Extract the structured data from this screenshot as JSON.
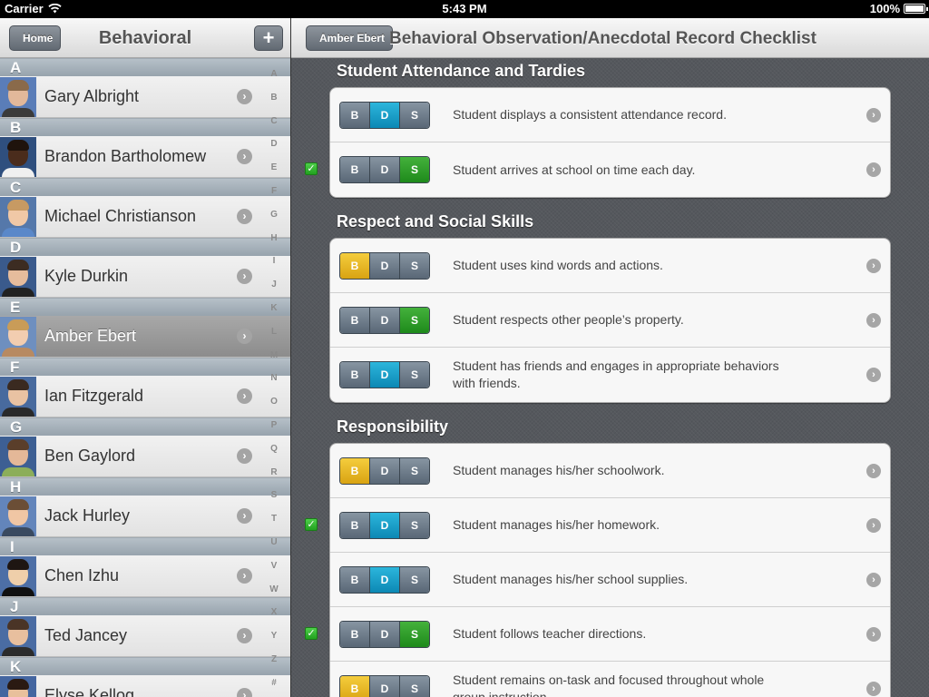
{
  "status_bar": {
    "carrier": "Carrier",
    "time": "5:43 PM",
    "battery": "100%"
  },
  "master": {
    "title": "Behavioral",
    "home_label": "Home",
    "add_label": "+",
    "sections": [
      {
        "letter": "A",
        "student": "Gary Albright",
        "skin": "#e2b89a",
        "hair": "#8a6a4a",
        "shirt": "#3b3b3b",
        "bg": "#5a7db8"
      },
      {
        "letter": "B",
        "student": "Brandon Bartholomew",
        "skin": "#4a2c1c",
        "hair": "#1f130c",
        "shirt": "#f0f0f0",
        "bg": "#2f4f7e"
      },
      {
        "letter": "C",
        "student": "Michael Christianson",
        "skin": "#f0c8a6",
        "hair": "#c79a63",
        "shirt": "#5a88c9",
        "bg": "#5578aa"
      },
      {
        "letter": "D",
        "student": "Kyle Durkin",
        "skin": "#e6bc9c",
        "hair": "#3c2c22",
        "shirt": "#222222",
        "bg": "#3a5a8c"
      },
      {
        "letter": "E",
        "student": "Amber Ebert",
        "skin": "#f2cdb0",
        "hair": "#c99c58",
        "shirt": "#b78a62",
        "bg": "#6e8fbf",
        "selected": true
      },
      {
        "letter": "F",
        "student": "Ian Fitzgerald",
        "skin": "#e9c2a2",
        "hair": "#3a2a20",
        "shirt": "#2a2a2a",
        "bg": "#486a9e"
      },
      {
        "letter": "G",
        "student": "Ben Gaylord",
        "skin": "#e4b898",
        "hair": "#5a3e2a",
        "shirt": "#8cae5a",
        "bg": "#3d5f93"
      },
      {
        "letter": "H",
        "student": "Jack Hurley",
        "skin": "#f0c6a4",
        "hair": "#6b4e36",
        "shirt": "#3a4a60",
        "bg": "#6385bb"
      },
      {
        "letter": "I",
        "student": "Chen Izhu",
        "skin": "#efcfaa",
        "hair": "#1e1612",
        "shirt": "#111111",
        "bg": "#4d6fa6"
      },
      {
        "letter": "J",
        "student": "Ted Jancey",
        "skin": "#e8bf9e",
        "hair": "#4a3426",
        "shirt": "#2c2c2c",
        "bg": "#4a6ca3"
      },
      {
        "letter": "K",
        "student": "Elyse Kellog",
        "skin": "#e8c09c",
        "hair": "#2a1a12",
        "shirt": "#7a3a3a",
        "bg": "#4466a0"
      }
    ],
    "index_letters": [
      "A",
      "B",
      "C",
      "D",
      "E",
      "F",
      "G",
      "H",
      "I",
      "J",
      "K",
      "L",
      "M",
      "N",
      "O",
      "P",
      "Q",
      "R",
      "S",
      "T",
      "U",
      "V",
      "W",
      "X",
      "Y",
      "Z",
      "#"
    ]
  },
  "detail": {
    "back_label": "Amber Ebert",
    "title": "Behavioral Observation/Anecdotal Record Checklist",
    "options": [
      "B",
      "D",
      "S"
    ],
    "sections": [
      {
        "title": "Student Attendance and Tardies",
        "items": [
          {
            "text": "Student displays a consistent attendance record.",
            "selected": "D",
            "checked": false
          },
          {
            "text": "Student arrives at school on time each day.",
            "selected": "S",
            "checked": true
          }
        ]
      },
      {
        "title": "Respect and Social Skills",
        "items": [
          {
            "text": "Student uses kind words and actions.",
            "selected": "B",
            "checked": false
          },
          {
            "text": "Student respects other people’s property.",
            "selected": "S",
            "checked": false
          },
          {
            "text": "Student has friends and engages in appropriate behaviors with friends.",
            "selected": "D",
            "checked": false
          }
        ]
      },
      {
        "title": "Responsibility",
        "items": [
          {
            "text": "Student manages his/her schoolwork.",
            "selected": "B",
            "checked": false
          },
          {
            "text": "Student manages his/her homework.",
            "selected": "D",
            "checked": true
          },
          {
            "text": "Student manages his/her school supplies.",
            "selected": "D",
            "checked": false
          },
          {
            "text": "Student follows teacher directions.",
            "selected": "S",
            "checked": true
          },
          {
            "text": "Student remains on-task and focused throughout whole group instruction.",
            "selected": "B",
            "checked": false
          }
        ]
      }
    ]
  }
}
